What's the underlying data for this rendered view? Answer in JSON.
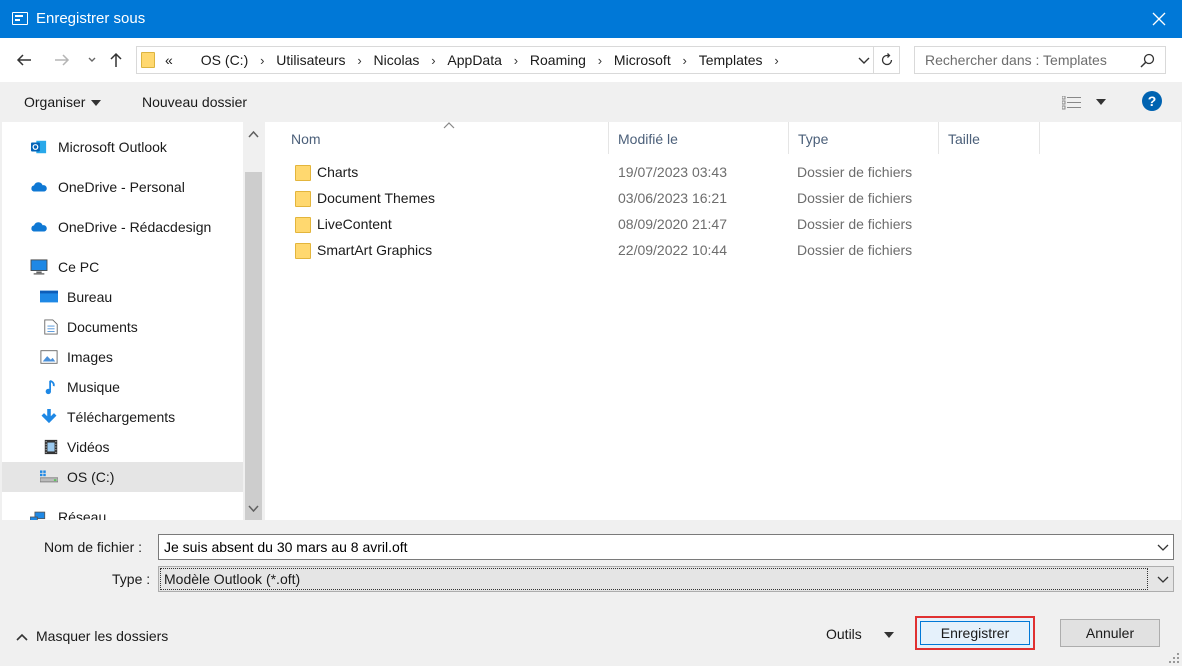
{
  "window": {
    "title": "Enregistrer sous",
    "accent": "#0078d7"
  },
  "address": {
    "prefix": "«",
    "crumbs": [
      "OS (C:)",
      "Utilisateurs",
      "Nicolas",
      "AppData",
      "Roaming",
      "Microsoft",
      "Templates"
    ]
  },
  "search": {
    "placeholder": "Rechercher dans : Templates"
  },
  "toolbar": {
    "organize": "Organiser",
    "new_folder": "Nouveau dossier",
    "help": "?"
  },
  "nav": {
    "items": [
      {
        "label": "Microsoft Outlook",
        "icon": "outlook-icon"
      },
      {
        "label": "OneDrive - Personal",
        "icon": "onedrive-icon"
      },
      {
        "label": "OneDrive - Rédacdesign",
        "icon": "onedrive-icon"
      },
      {
        "label": "Ce PC",
        "icon": "pc-icon"
      },
      {
        "label": "Bureau",
        "icon": "desktop-icon"
      },
      {
        "label": "Documents",
        "icon": "documents-icon"
      },
      {
        "label": "Images",
        "icon": "images-icon"
      },
      {
        "label": "Musique",
        "icon": "music-icon"
      },
      {
        "label": "Téléchargements",
        "icon": "download-icon"
      },
      {
        "label": "Vidéos",
        "icon": "videos-icon"
      },
      {
        "label": "OS (C:)",
        "icon": "drive-icon",
        "selected": true
      },
      {
        "label": "Réseau",
        "icon": "network-icon"
      }
    ]
  },
  "files": {
    "columns": [
      "Nom",
      "Modifié le",
      "Type",
      "Taille"
    ],
    "rows": [
      {
        "name": "Charts",
        "modified": "19/07/2023 03:43",
        "type": "Dossier de fichiers"
      },
      {
        "name": "Document Themes",
        "modified": "03/06/2023 16:21",
        "type": "Dossier de fichiers"
      },
      {
        "name": "LiveContent",
        "modified": "08/09/2020 21:47",
        "type": "Dossier de fichiers"
      },
      {
        "name": "SmartArt Graphics",
        "modified": "22/09/2022 10:44",
        "type": "Dossier de fichiers"
      }
    ]
  },
  "form": {
    "filename_label": "Nom de fichier :",
    "filename_value": "Je suis absent du 30 mars au 8 avril.oft",
    "type_label": "Type :",
    "type_value": "Modèle Outlook (*.oft)"
  },
  "footer": {
    "hide_folders": "Masquer les dossiers",
    "tools": "Outils",
    "save": "Enregistrer",
    "cancel": "Annuler",
    "highlight_color": "#e03131"
  }
}
